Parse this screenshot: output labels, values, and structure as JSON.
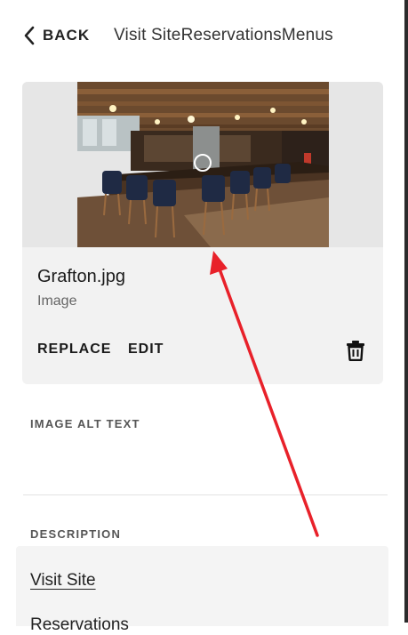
{
  "header": {
    "back_label": "BACK",
    "title": "Visit SiteReservationsMenus"
  },
  "image_card": {
    "file_name": "Grafton.jpg",
    "file_type": "Image",
    "replace_label": "REPLACE",
    "edit_label": "EDIT",
    "thumbnail_description_icon": "restaurant-bar-photo"
  },
  "alt_text": {
    "label": "IMAGE ALT TEXT",
    "value": ""
  },
  "description": {
    "label": "DESCRIPTION",
    "link_text": "Visit Site",
    "next_line": "Reservations"
  },
  "colors": {
    "accent_annotation": "#e8212a",
    "card_bg": "#f2f2f2"
  }
}
